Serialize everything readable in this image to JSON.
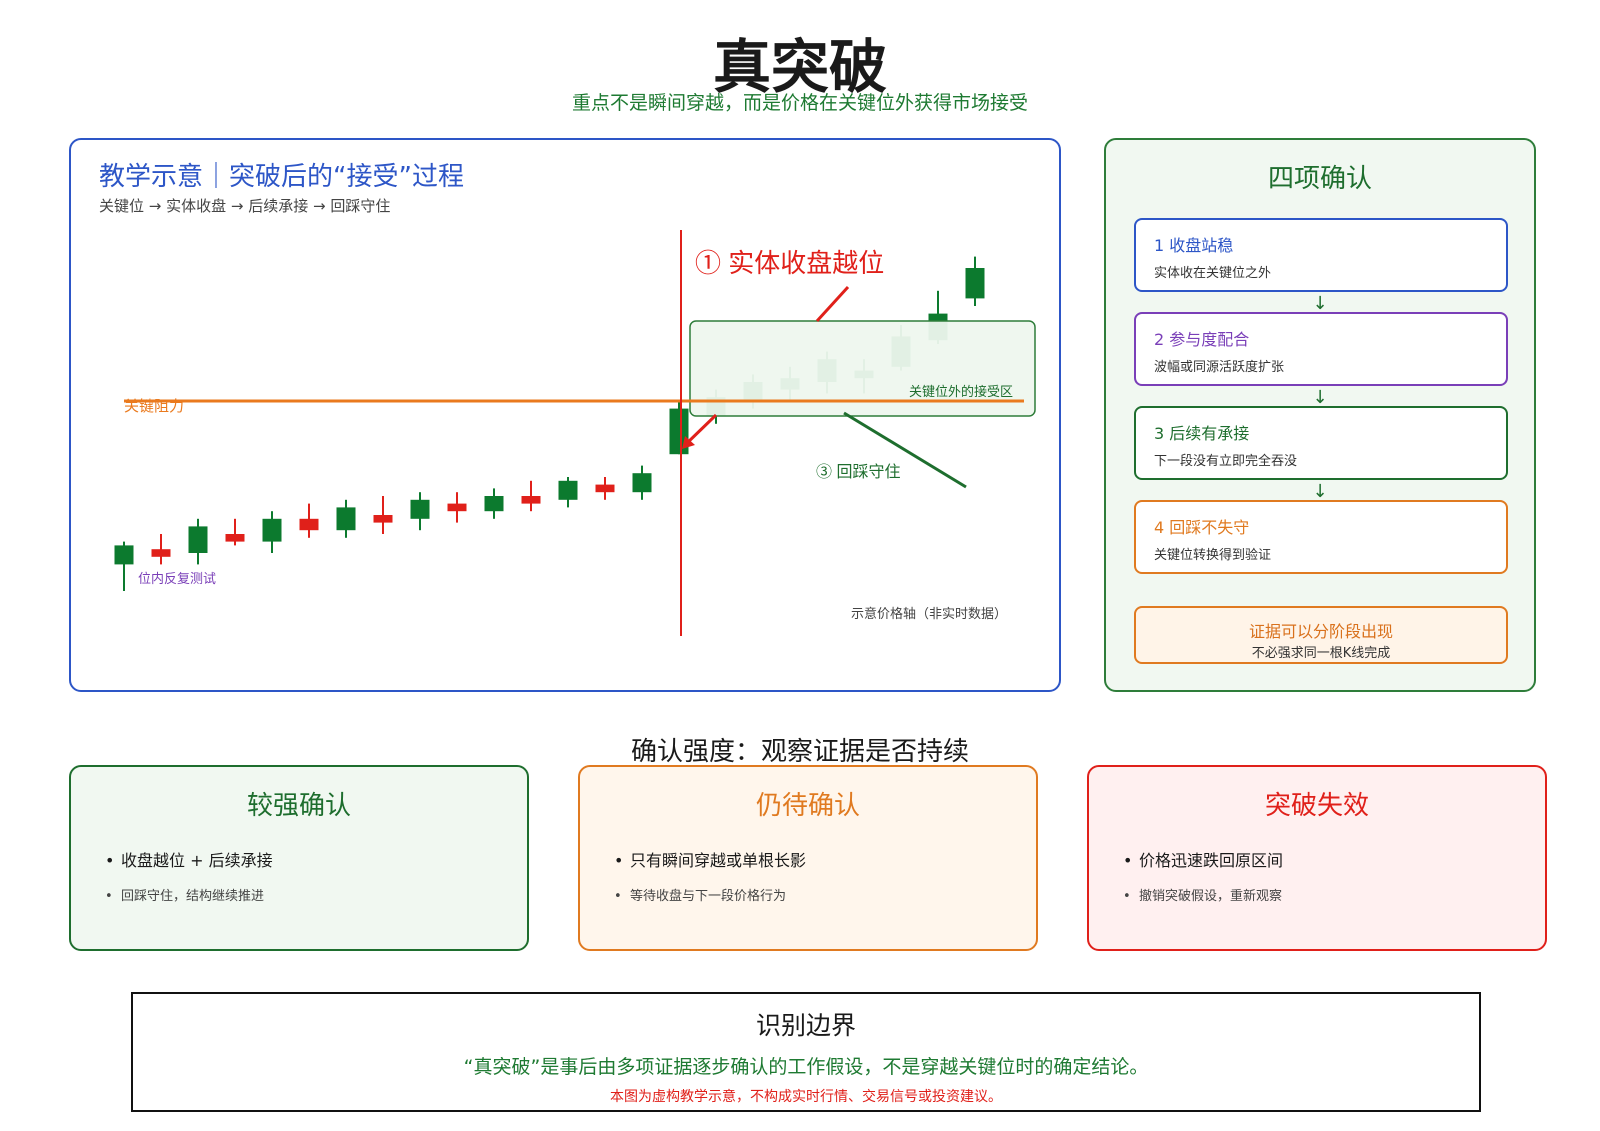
{
  "header": {
    "title": "真突破",
    "subtitle": "重点不是瞬间穿越，而是价格在关键位外获得市场接受"
  },
  "main_panel": {
    "title": "教学示意｜突破后的“接受”过程",
    "subtitle": "关键位 → 实体收盘 → 后续承接 → 回踩守住",
    "resistance_label": "关键阻力",
    "annotation_1": "① 实体收盘越位",
    "annotation_3": "③ 回踩守住",
    "inside_label": "位内反复测试",
    "acceptance_zone_label": "关键位外的接受区",
    "axis_note": "示意价格轴（非实时数据）",
    "colors": {
      "up": "#0c7a2e",
      "down": "#e0201a",
      "resistance": "#ea7a1e",
      "breakout_line": "#e0201a"
    }
  },
  "confirm_panel": {
    "title": "四项确认",
    "steps": [
      {
        "title": "1 收盘站稳",
        "desc": "实体收在关键位之外",
        "color": "#2d56c7"
      },
      {
        "title": "2 参与度配合",
        "desc": "波幅或同源活跃度扩张",
        "color": "#7a3fb8"
      },
      {
        "title": "3 后续有承接",
        "desc": "下一段没有立即完全吞没",
        "color": "#1e6e2e"
      },
      {
        "title": "4 回踩不失守",
        "desc": "关键位转换得到验证",
        "color": "#e07a20"
      }
    ],
    "arrow_glyph": "↓",
    "evidence_main": "证据可以分阶段出现",
    "evidence_sub": "不必强求同一根K线完成"
  },
  "strength": {
    "heading": "确认强度：观察证据是否持续",
    "bullet": "•",
    "cards": [
      {
        "title": "较强确认",
        "line1": "收盘越位 + 后续承接",
        "line2": "回踩守住，结构继续推进",
        "color": "#1e6e2e",
        "bg": "#f1f8f1"
      },
      {
        "title": "仍待确认",
        "line1": "只有瞬间穿越或单根长影",
        "line2": "等待收盘与下一段价格行为",
        "color": "#e07a20",
        "bg": "#fff6ec"
      },
      {
        "title": "突破失效",
        "line1": "价格迅速跌回原区间",
        "line2": "撤销突破假设，重新观察",
        "color": "#e0201a",
        "bg": "#fff0f0"
      }
    ]
  },
  "boundary": {
    "title": "识别边界",
    "text": "“真突破”是事后由多项证据逐步确认的工作假设，不是穿越关键位时的确定结论。",
    "disclaimer": "本图为虚构教学示意，不构成实时行情、交易信号或投资建议。"
  },
  "chart_data": {
    "type": "candlestick",
    "title": "",
    "xlabel": "",
    "ylabel": "",
    "ylim": [
      0,
      100
    ],
    "resistance_level": 55,
    "candles": [
      {
        "open": 12,
        "high": 18,
        "low": 5,
        "close": 17
      },
      {
        "open": 16,
        "high": 20,
        "low": 12,
        "close": 14
      },
      {
        "open": 15,
        "high": 24,
        "low": 12,
        "close": 22
      },
      {
        "open": 20,
        "high": 24,
        "low": 17,
        "close": 18
      },
      {
        "open": 18,
        "high": 26,
        "low": 15,
        "close": 24
      },
      {
        "open": 24,
        "high": 28,
        "low": 19,
        "close": 21
      },
      {
        "open": 21,
        "high": 29,
        "low": 19,
        "close": 27
      },
      {
        "open": 25,
        "high": 30,
        "low": 20,
        "close": 23
      },
      {
        "open": 24,
        "high": 31,
        "low": 21,
        "close": 29
      },
      {
        "open": 28,
        "high": 31,
        "low": 23,
        "close": 26
      },
      {
        "open": 26,
        "high": 32,
        "low": 24,
        "close": 30
      },
      {
        "open": 30,
        "high": 34,
        "low": 26,
        "close": 28
      },
      {
        "open": 29,
        "high": 35,
        "low": 27,
        "close": 34
      },
      {
        "open": 33,
        "high": 35,
        "low": 29,
        "close": 31
      },
      {
        "open": 31,
        "high": 38,
        "low": 29,
        "close": 36
      },
      {
        "open": 41,
        "high": 55,
        "low": 41,
        "close": 53
      },
      {
        "open": 51,
        "high": 58,
        "low": 49,
        "close": 56
      },
      {
        "open": 55,
        "high": 62,
        "low": 53,
        "close": 60
      },
      {
        "open": 58,
        "high": 64,
        "low": 55,
        "close": 61
      },
      {
        "open": 60,
        "high": 68,
        "low": 57,
        "close": 66
      },
      {
        "open": 61,
        "high": 66,
        "low": 57,
        "close": 63
      },
      {
        "open": 64,
        "high": 75,
        "low": 63,
        "close": 72
      },
      {
        "open": 71,
        "high": 84,
        "low": 70,
        "close": 78
      },
      {
        "open": 82,
        "high": 93,
        "low": 80,
        "close": 90
      }
    ]
  }
}
